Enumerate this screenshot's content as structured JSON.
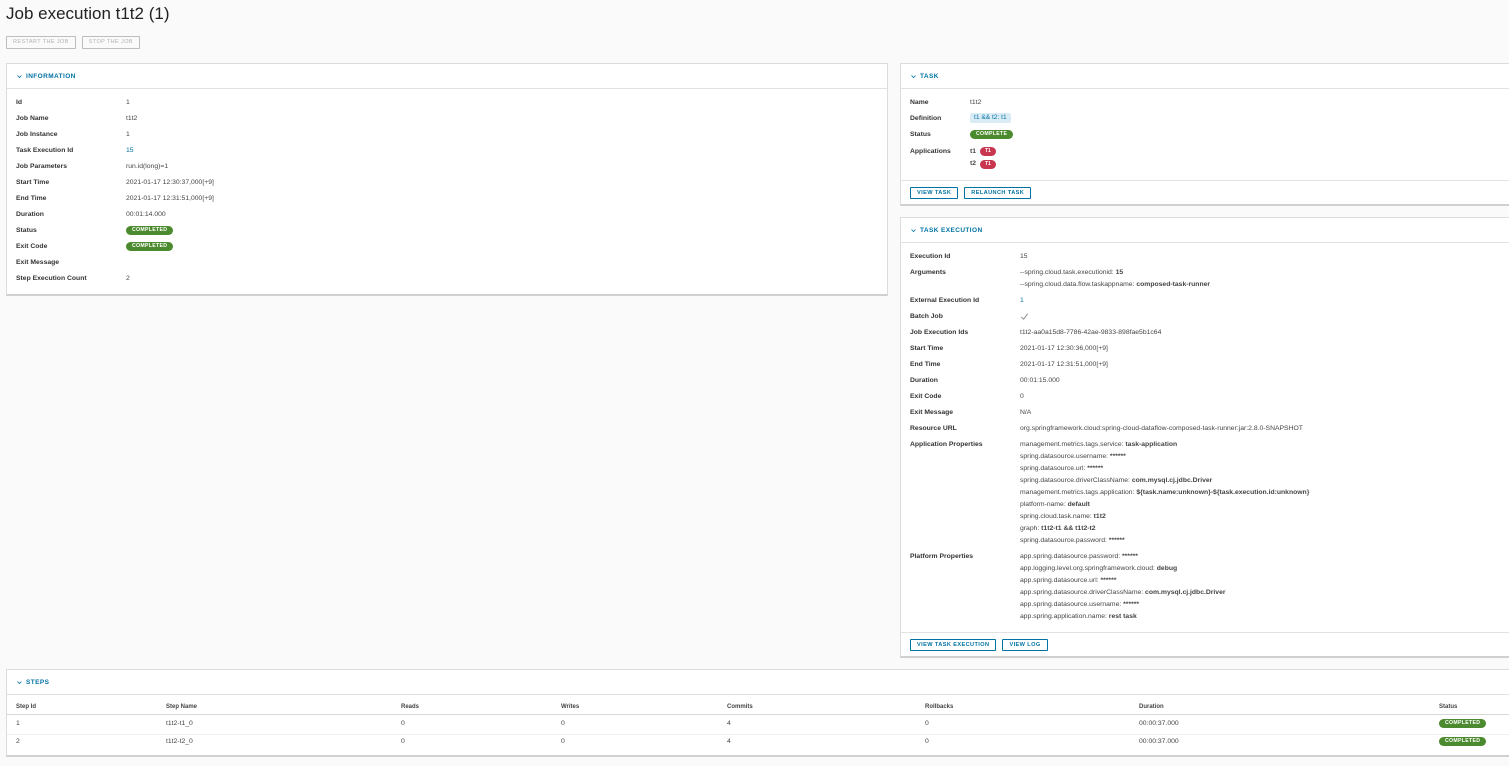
{
  "page": {
    "title": "Job execution t1t2 (1)",
    "restart_label": "RESTART THE JOB",
    "stop_label": "STOP THE JOB"
  },
  "information": {
    "header": "INFORMATION",
    "rows": [
      {
        "label": "Id",
        "value": "1"
      },
      {
        "label": "Job Name",
        "value": "t1t2"
      },
      {
        "label": "Job Instance",
        "value": "1"
      },
      {
        "label": "Task Execution Id",
        "value": "15"
      },
      {
        "label": "Job Parameters",
        "value": "run.id(long)=1"
      },
      {
        "label": "Start Time",
        "value": "2021-01-17 12:30:37,000[+9]"
      },
      {
        "label": "End Time",
        "value": "2021-01-17 12:31:51,000[+9]"
      },
      {
        "label": "Duration",
        "value": "00:01:14.000"
      },
      {
        "label": "Status",
        "value": "COMPLETED"
      },
      {
        "label": "Exit Code",
        "value": "COMPLETED"
      },
      {
        "label": "Exit Message",
        "value": ""
      },
      {
        "label": "Step Execution Count",
        "value": "2"
      }
    ]
  },
  "task": {
    "header": "TASK",
    "name_label": "Name",
    "name": "t1t2",
    "definition_label": "Definition",
    "definition": "t1 && t2: t1",
    "status_label": "Status",
    "status": "COMPLETE",
    "applications_label": "Applications",
    "applications": [
      {
        "name": "t1",
        "badge": "T1"
      },
      {
        "name": "t2",
        "badge": "T1"
      }
    ],
    "view_task_label": "VIEW TASK",
    "relaunch_label": "RELAUNCH TASK"
  },
  "task_execution": {
    "header": "TASK EXECUTION",
    "execution_id_label": "Execution Id",
    "execution_id": "15",
    "arguments_label": "Arguments",
    "arguments": [
      {
        "key": "--spring.cloud.task.executionid:",
        "value": "15"
      },
      {
        "key": "--spring.cloud.data.flow.taskappname:",
        "value": "composed-task-runner"
      }
    ],
    "external_id_label": "External Execution Id",
    "external_id": "1",
    "batch_job_label": "Batch Job",
    "batch_job_icon": "check-icon",
    "job_execution_ids_label": "Job Execution Ids",
    "job_execution_ids": "t1t2-aa0a15d8-7786-42ae-9833-898fae5b1c64",
    "start_time_label": "Start Time",
    "start_time": "2021-01-17 12:30:36,000[+9]",
    "end_time_label": "End Time",
    "end_time": "2021-01-17 12:31:51,000[+9]",
    "duration_label": "Duration",
    "duration": "00:01:15.000",
    "exit_code_label": "Exit Code",
    "exit_code": "0",
    "exit_message_label": "Exit Message",
    "exit_message": "N/A",
    "resource_url_label": "Resource URL",
    "resource_url": "org.springframework.cloud:spring-cloud-dataflow-composed-task-runner:jar:2.8.0-SNAPSHOT",
    "app_props_label": "Application Properties",
    "app_props": [
      {
        "key": "management.metrics.tags.service:",
        "value": "task-application"
      },
      {
        "key": "spring.datasource.username:",
        "value": "******"
      },
      {
        "key": "spring.datasource.url:",
        "value": "******"
      },
      {
        "key": "spring.datasource.driverClassName:",
        "value": "com.mysql.cj.jdbc.Driver"
      },
      {
        "key": "management.metrics.tags.application:",
        "value": "${task.name:unknown}-${task.execution.id:unknown}"
      },
      {
        "key": "platform-name:",
        "value": "default"
      },
      {
        "key": "spring.cloud.task.name:",
        "value": "t1t2"
      },
      {
        "key": "graph:",
        "value": "t1t2-t1 && t1t2-t2"
      },
      {
        "key": "spring.datasource.password:",
        "value": "******"
      }
    ],
    "platform_props_label": "Platform Properties",
    "platform_props": [
      {
        "key": "app.spring.datasource.password:",
        "value": "******"
      },
      {
        "key": "app.logging.level.org.springframework.cloud:",
        "value": "debug"
      },
      {
        "key": "app.spring.datasource.url:",
        "value": "******"
      },
      {
        "key": "app.spring.datasource.driverClassName:",
        "value": "com.mysql.cj.jdbc.Driver"
      },
      {
        "key": "app.spring.datasource.username:",
        "value": "******"
      },
      {
        "key": "app.spring.application.name:",
        "value": "rest task"
      }
    ],
    "view_execution_label": "VIEW TASK EXECUTION",
    "view_log_label": "VIEW LOG"
  },
  "steps": {
    "header": "STEPS",
    "columns": [
      "Step Id",
      "Step Name",
      "Reads",
      "Writes",
      "Commits",
      "Rollbacks",
      "Duration",
      "Status"
    ],
    "rows": [
      {
        "id": "1",
        "name": "t1t2-t1_0",
        "reads": "0",
        "writes": "0",
        "commits": "4",
        "rollbacks": "0",
        "duration": "00:00:37.000",
        "status": "COMPLETED"
      },
      {
        "id": "2",
        "name": "t1t2-t2_0",
        "reads": "0",
        "writes": "0",
        "commits": "4",
        "rollbacks": "0",
        "duration": "00:00:37.000",
        "status": "COMPLETED"
      }
    ]
  },
  "colors": {
    "link": "#0072a3",
    "success": "#4b8a2e",
    "danger": "#c83650",
    "info_bg": "#d9ecf6"
  }
}
